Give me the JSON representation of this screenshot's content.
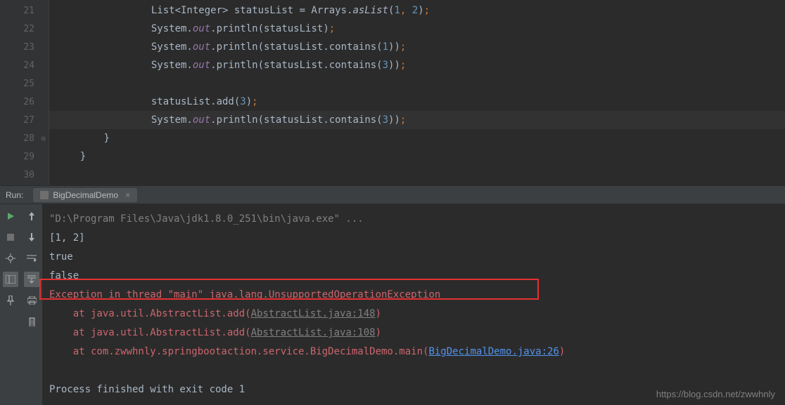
{
  "editor": {
    "lineNumbers": [
      "21",
      "22",
      "23",
      "24",
      "25",
      "26",
      "27",
      "28",
      "29",
      "30"
    ],
    "highlightedLine": 27,
    "code": {
      "l21": {
        "indent": "                ",
        "p1": "List<Integer> statusList = Arrays.",
        "m1": "asList",
        "p2": "(",
        "n1": "1",
        "c1": ", ",
        "n2": "2",
        "p3": ")",
        "s": ";"
      },
      "l22": {
        "indent": "                ",
        "p1": "System.",
        "f1": "out",
        "p2": ".println(statusList)",
        "s": ";"
      },
      "l23": {
        "indent": "                ",
        "p1": "System.",
        "f1": "out",
        "p2": ".println(statusList.contains(",
        "n1": "1",
        "p3": "))",
        "s": ";"
      },
      "l24": {
        "indent": "                ",
        "p1": "System.",
        "f1": "out",
        "p2": ".println(statusList.contains(",
        "n1": "3",
        "p3": "))",
        "s": ";"
      },
      "l26": {
        "indent": "                ",
        "p1": "statusList.add(",
        "n1": "3",
        "p2": ")",
        "s": ";"
      },
      "l27": {
        "indent": "                ",
        "p1": "System.",
        "f1": "out",
        "p2": ".println(statusList.contains(",
        "n1": "3",
        "p3": "))",
        "s": ";"
      },
      "l28": {
        "indent": "        ",
        "br": "}"
      },
      "l29": {
        "indent": "    ",
        "br": "}"
      }
    }
  },
  "panel": {
    "runLabel": "Run:",
    "tabName": "BigDecimalDemo"
  },
  "console": {
    "cmd": "\"D:\\Program Files\\Java\\jdk1.8.0_251\\bin\\java.exe\" ...",
    "out1": "[1, 2]",
    "out2": "true",
    "out3": "false",
    "exception": "Exception in thread \"main\" java.lang.UnsupportedOperationException",
    "at1_pre": "    at java.util.AbstractList.add(",
    "at1_link": "AbstractList.java:148",
    "at1_post": ")",
    "at2_pre": "    at java.util.AbstractList.add(",
    "at2_link": "AbstractList.java:108",
    "at2_post": ")",
    "at3_pre": "    at com.zwwhnly.springbootaction.service.BigDecimalDemo.main(",
    "at3_link": "BigDecimalDemo.java:26",
    "at3_post": ")",
    "finished": "Process finished with exit code 1"
  },
  "watermark": "https://blog.csdn.net/zwwhnly"
}
